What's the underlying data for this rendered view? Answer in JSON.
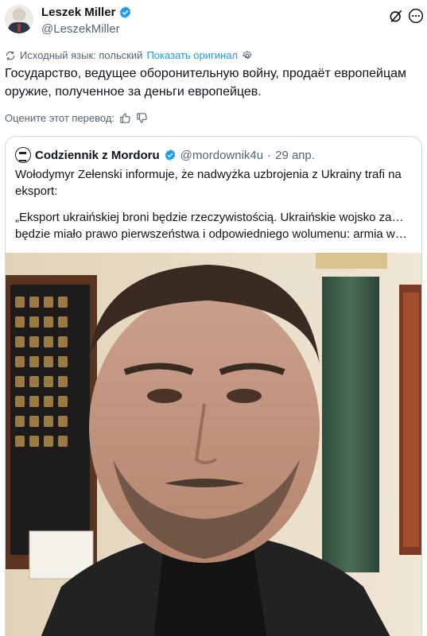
{
  "author": {
    "name": "Leszek Miller",
    "handle": "@LeszekMiller",
    "verified_icon": "verified-badge-icon"
  },
  "header_icons": [
    "grok-icon",
    "more-icon"
  ],
  "translation": {
    "source_language_text": "Исходный язык: польский",
    "show_original_label": "Показать оригинал",
    "settings_icon": "gear-icon"
  },
  "tweet": {
    "text": "Государство, ведущее оборонительную войну, продаёт европейцам оружие, полученное за деньги европейцев."
  },
  "rating": {
    "label": "Оцените этот перевод:",
    "icons": [
      "thumbs-up-icon",
      "thumbs-down-icon"
    ]
  },
  "quoted_post": {
    "name": "Codziennik z Mordoru",
    "handle": "@mordownik4u",
    "separator": "·",
    "date": "29 апр.",
    "paragraph1": "Wołodymyr Zełenski informuje, że nadwyżka uzbrojenia z Ukrainy trafi na eksport:",
    "paragraph2_line1": "„Eksport ukraińskiej broni będzie rzeczywistością. Ukraińskie wojsko zawsze",
    "paragraph2_line2": "będzie miało prawo pierwszeństwa i odpowiedniego wolumenu: armia weźmi..."
  },
  "colors": {
    "verified": "#1d9bf0",
    "link": "#1d9bf0",
    "secondary_text": "#536471",
    "border": "#cfd9de"
  }
}
